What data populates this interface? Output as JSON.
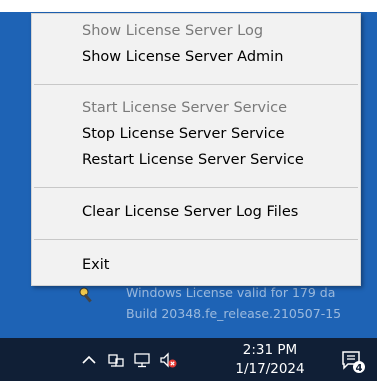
{
  "menu": {
    "items": [
      {
        "label": "Show License Server Log",
        "disabled": true
      },
      {
        "label": "Show License Server Admin",
        "disabled": false
      },
      {
        "label": "Start License Server Service",
        "disabled": true
      },
      {
        "label": "Stop License Server Service",
        "disabled": false
      },
      {
        "label": "Restart License Server Service",
        "disabled": false
      },
      {
        "label": "Clear License Server Log Files",
        "disabled": false
      },
      {
        "label": "Exit",
        "disabled": false
      }
    ]
  },
  "desktop": {
    "watermark_line1": "Windows License valid for 179 da",
    "watermark_line2": "Build 20348.fe_release.210507-15"
  },
  "taskbar": {
    "time": "2:31 PM",
    "date": "1/17/2024",
    "notification_count": "4",
    "icons": [
      "chevron-up-icon",
      "network-icon",
      "monitor-icon",
      "speaker-muted-icon",
      "notification-icon"
    ]
  }
}
